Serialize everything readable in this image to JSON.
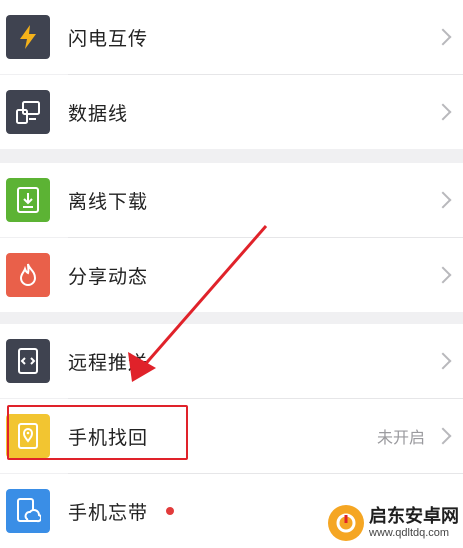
{
  "items": [
    {
      "label": "闪电互传",
      "icon": "lightning-icon",
      "icon_bg": "#3f4350"
    },
    {
      "label": "数据线",
      "icon": "pc-connect-icon",
      "icon_bg": "#3f4350"
    },
    {
      "label": "离线下载",
      "icon": "download-icon",
      "icon_bg": "#5cb334"
    },
    {
      "label": "分享动态",
      "icon": "flame-icon",
      "icon_bg": "#e9604a"
    },
    {
      "label": "远程推送",
      "icon": "remote-push-icon",
      "icon_bg": "#3f4350"
    },
    {
      "label": "手机找回",
      "icon": "location-pin-icon",
      "icon_bg": "#f2c531",
      "status": "未开启"
    },
    {
      "label": "手机忘带",
      "icon": "phone-cloud-icon",
      "icon_bg": "#3a8ee6"
    }
  ],
  "colors": {
    "highlight": "#e0222a",
    "arrow": "#e0222a",
    "red_dot": "#e23b3b"
  },
  "watermark": {
    "title": "启东安卓网",
    "url": "www.qdltdq.com"
  }
}
